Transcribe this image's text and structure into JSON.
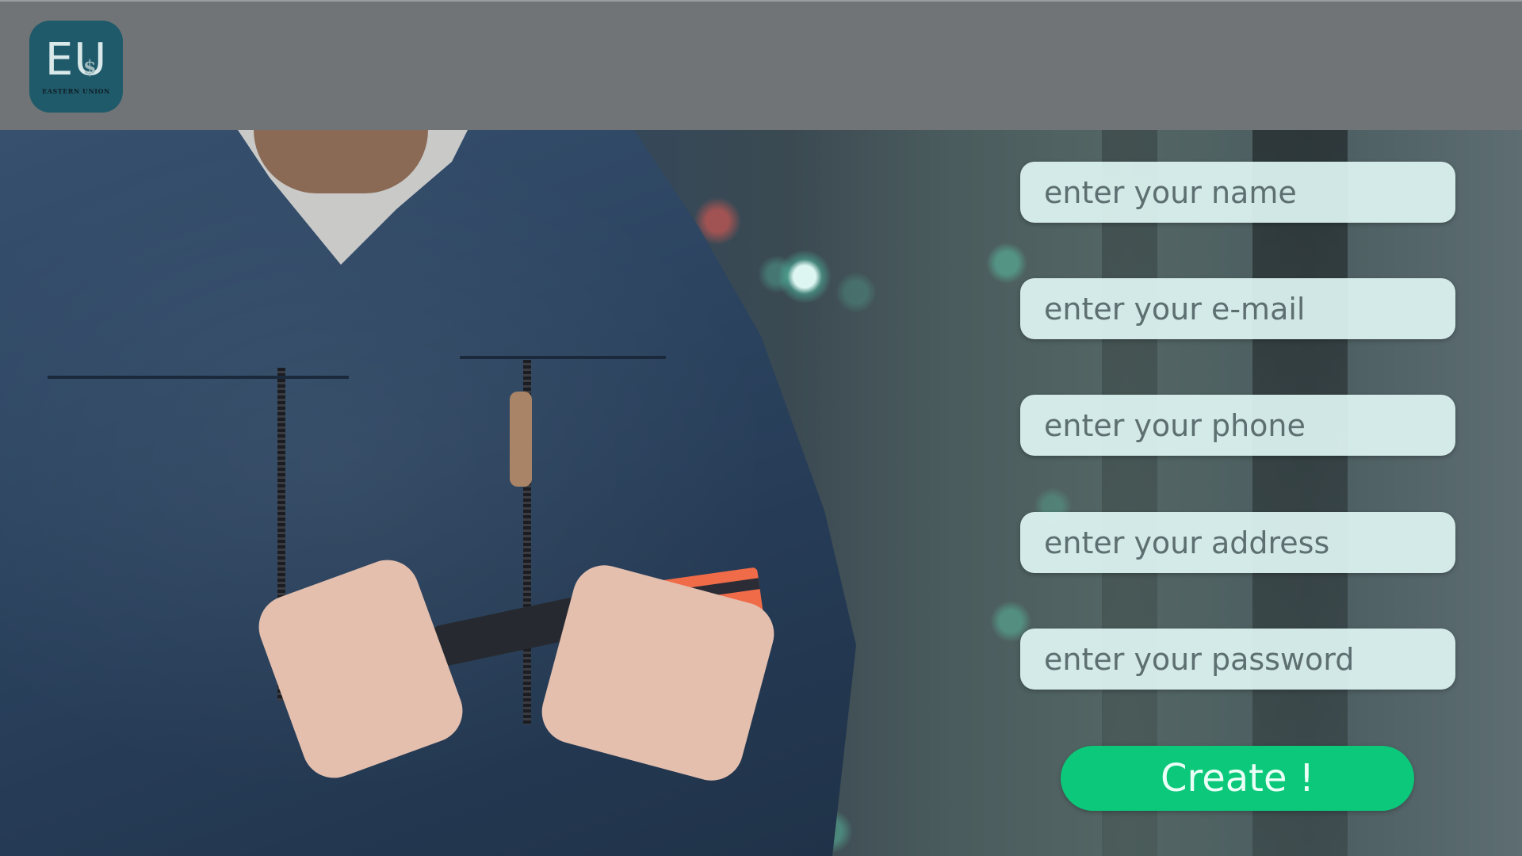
{
  "header": {
    "logo": {
      "mark": "EU",
      "symbol": "$",
      "text": "EASTERN UNION"
    }
  },
  "form": {
    "fields": [
      {
        "id": "name",
        "placeholder": "enter your name",
        "type": "text"
      },
      {
        "id": "email",
        "placeholder": "enter your e-mail",
        "type": "email"
      },
      {
        "id": "phone",
        "placeholder": "enter your phone",
        "type": "tel"
      },
      {
        "id": "address",
        "placeholder": "enter your address",
        "type": "text"
      },
      {
        "id": "password",
        "placeholder": "enter your password",
        "type": "password"
      }
    ],
    "submit_label": "Create !"
  },
  "colors": {
    "header_bg": "#707476",
    "logo_bg": "#1f5a6b",
    "field_bg": "#def4f2",
    "button_bg": "#0cc87a"
  }
}
